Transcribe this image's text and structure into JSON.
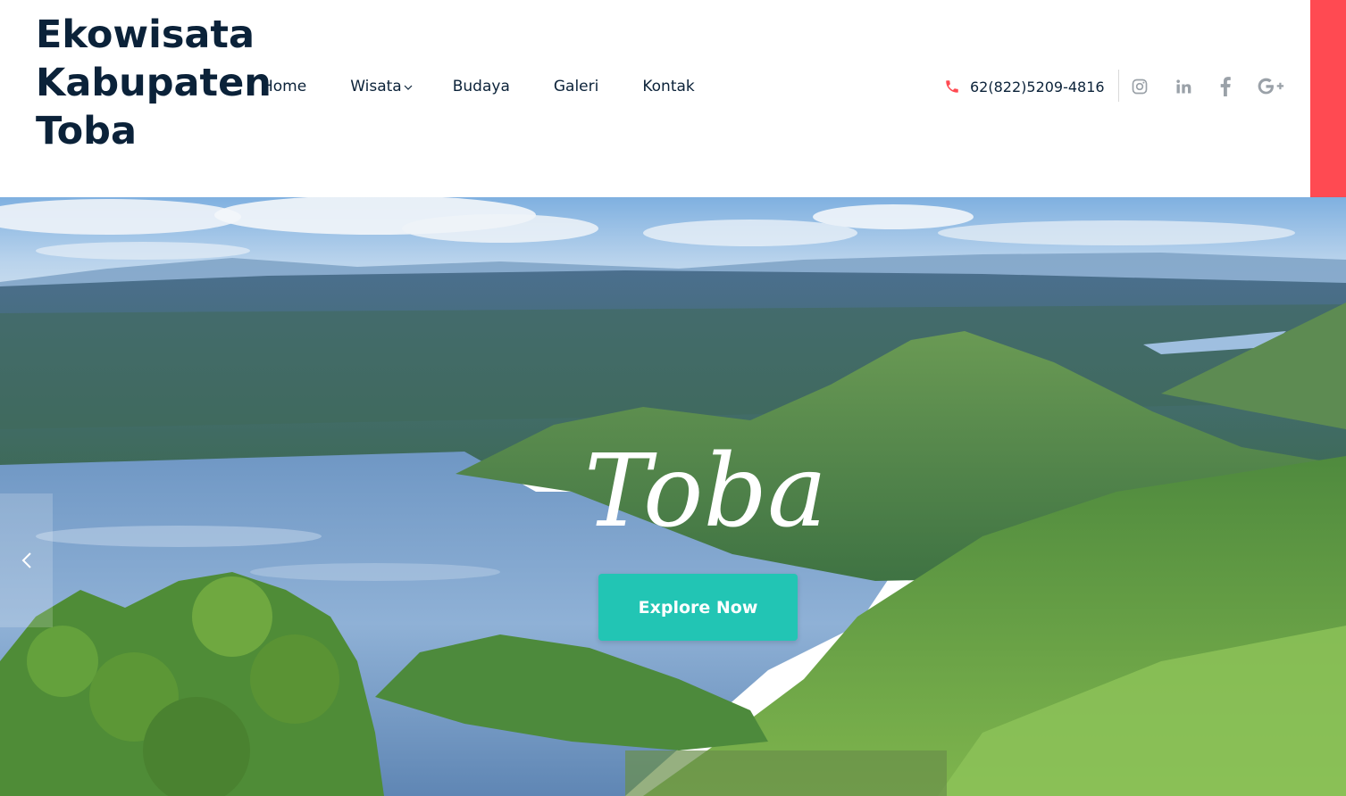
{
  "brand": {
    "line1": "Ekowisata",
    "line2": "Kabupaten",
    "line3": "Toba"
  },
  "nav": [
    {
      "label": "Home"
    },
    {
      "label": "Wisata",
      "has_dropdown": true
    },
    {
      "label": "Budaya"
    },
    {
      "label": "Galeri"
    },
    {
      "label": "Kontak"
    }
  ],
  "contact": {
    "phone": "62(822)5209-4816",
    "icon": "phone-icon"
  },
  "social": [
    "instagram-icon",
    "linkedin-icon",
    "facebook-icon",
    "google-plus-icon"
  ],
  "hero": {
    "title": "Toba",
    "cta_label": "Explore Now",
    "prev_icon": "chevron-left-icon"
  },
  "colors": {
    "brand_text": "#0b2239",
    "accent": "#ff4a52",
    "cta": "#22c5b4",
    "social_icon": "#9aa1a8"
  }
}
